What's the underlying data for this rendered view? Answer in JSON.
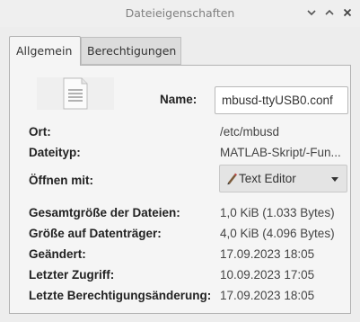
{
  "window": {
    "title": "Dateieigenschaften",
    "controls": {
      "minimize": "⌄",
      "maximize": "⌃",
      "close": "×"
    }
  },
  "tabs": [
    {
      "label": "Allgemein",
      "active": true
    },
    {
      "label": "Berechtigungen",
      "active": false
    }
  ],
  "general": {
    "file_icon": "text-document-icon",
    "name_label": "Name:",
    "name_value": "mbusd-ttyUSB0.conf",
    "location_label": "Ort:",
    "location_value": "/etc/mbusd",
    "filetype_label": "Dateityp:",
    "filetype_value": "MATLAB-Skript/-Fun...",
    "open_with_label": "Öffnen mit:",
    "open_with_value": "Text Editor",
    "total_size_label": "Gesamtgröße der Dateien:",
    "total_size_value": "1,0 KiB (1.033 Bytes)",
    "disk_size_label": "Größe auf Datenträger:",
    "disk_size_value": "4,0 KiB (4.096 Bytes)",
    "modified_label": "Geändert:",
    "modified_value": "17.09.2023 18:05",
    "accessed_label": "Letzter Zugriff:",
    "accessed_value": "10.09.2023 17:05",
    "perm_changed_label": "Letzte Berechtigungsänderung:",
    "perm_changed_value": "17.09.2023 18:05"
  }
}
